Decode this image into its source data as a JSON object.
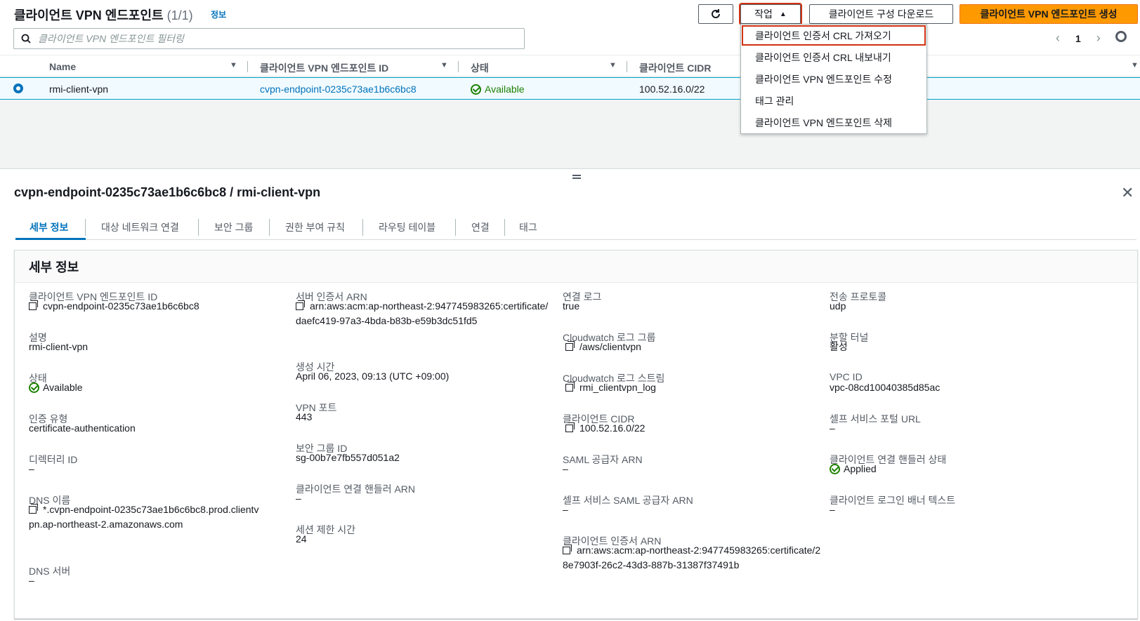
{
  "header": {
    "title": "클라이언트 VPN 엔드포인트",
    "count": "(1/1)",
    "info": "정보",
    "actions_label": "작업",
    "download_label": "클라이언트 구성 다운로드",
    "create_label": "클라이언트 VPN 엔드포인트 생성"
  },
  "search": {
    "placeholder": "클라이언트 VPN 엔드포인트 필터링"
  },
  "pager": {
    "page": "1",
    "prev": "‹",
    "next": "›"
  },
  "table": {
    "columns": [
      "Name",
      "클라이언트 VPN 엔드포인트 ID",
      "상태",
      "클라이언트 CIDR"
    ],
    "rows": [
      {
        "name": "rmi-client-vpn",
        "id": "cvpn-endpoint-0235c73ae1b6c6bc8",
        "status": "Available",
        "cidr": "100.52.16.0/22"
      }
    ]
  },
  "menu": {
    "items": [
      "클라이언트 인증서 CRL 가져오기",
      "클라이언트 인증서 CRL 내보내기",
      "클라이언트 VPN 엔드포인트 수정",
      "태그 관리",
      "클라이언트 VPN 엔드포인트 삭제"
    ]
  },
  "panel": {
    "title": "cvpn-endpoint-0235c73ae1b6c6bc8 / rmi-client-vpn",
    "tabs": [
      "세부 정보",
      "대상 네트워크 연결",
      "보안 그룹",
      "권한 부여 규칙",
      "라우팅 테이블",
      "연결",
      "태그"
    ]
  },
  "details": {
    "heading": "세부 정보",
    "col1": [
      {
        "label": "클라이언트 VPN 엔드포인트 ID",
        "value": "cvpn-endpoint-0235c73ae1b6c6bc8"
      },
      {
        "label": "설명",
        "value": "rmi-client-vpn"
      },
      {
        "label": "상태",
        "value": "Available"
      },
      {
        "label": "인증 유형",
        "value": "certificate-authentication"
      },
      {
        "label": "디렉터리 ID",
        "value": "–"
      },
      {
        "label": "DNS 이름",
        "value": "*.cvpn-endpoint-0235c73ae1b6c6bc8.prod.clientvpn.ap-northeast-2.amazonaws.com"
      },
      {
        "label": "DNS 서버",
        "value": "–"
      }
    ],
    "col2": [
      {
        "label": "서버 인증서 ARN",
        "value": "arn:aws:acm:ap-northeast-2:947745983265:certificate/daefc419-97a3-4bda-b83b-e59b3dc51fd5"
      },
      {
        "label": "생성 시간",
        "value": "April 06, 2023, 09:13 (UTC +09:00)"
      },
      {
        "label": "VPN 포트",
        "value": "443"
      },
      {
        "label": "보안 그룹 ID",
        "value": "sg-00b7e7fb557d051a2"
      },
      {
        "label": "클라이언트 연결 핸들러 ARN",
        "value": "–"
      },
      {
        "label": "세션 제한 시간",
        "value": "24"
      }
    ],
    "col3": [
      {
        "label": "연결 로그",
        "value": "true"
      },
      {
        "label": "Cloudwatch 로그 그룹",
        "value": "/aws/clientvpn"
      },
      {
        "label": "Cloudwatch 로그 스트림",
        "value": "rmi_clientvpn_log"
      },
      {
        "label": "클라이언트 CIDR",
        "value": "100.52.16.0/22"
      },
      {
        "label": "SAML 공급자 ARN",
        "value": "–"
      },
      {
        "label": "셀프 서비스 SAML 공급자 ARN",
        "value": "–"
      },
      {
        "label": "클라이언트 인증서 ARN",
        "value": "arn:aws:acm:ap-northeast-2:947745983265:certificate/28e7903f-26c2-43d3-887b-31387f37491b"
      }
    ],
    "col4": [
      {
        "label": "전송 프로토콜",
        "value": "udp"
      },
      {
        "label": "분할 터널",
        "value": "활성"
      },
      {
        "label": "VPC ID",
        "value": "vpc-08cd10040385d85ac"
      },
      {
        "label": "셀프 서비스 포털 URL",
        "value": "–"
      },
      {
        "label": "클라이언트 연결 핸들러 상태",
        "value": "Applied"
      },
      {
        "label": "클라이언트 로그인 배너 텍스트",
        "value": "–"
      }
    ]
  },
  "colors": {
    "link": "#0073bb",
    "primary": "#ff9900",
    "success": "#1d8102",
    "highlight": "#d13212"
  }
}
